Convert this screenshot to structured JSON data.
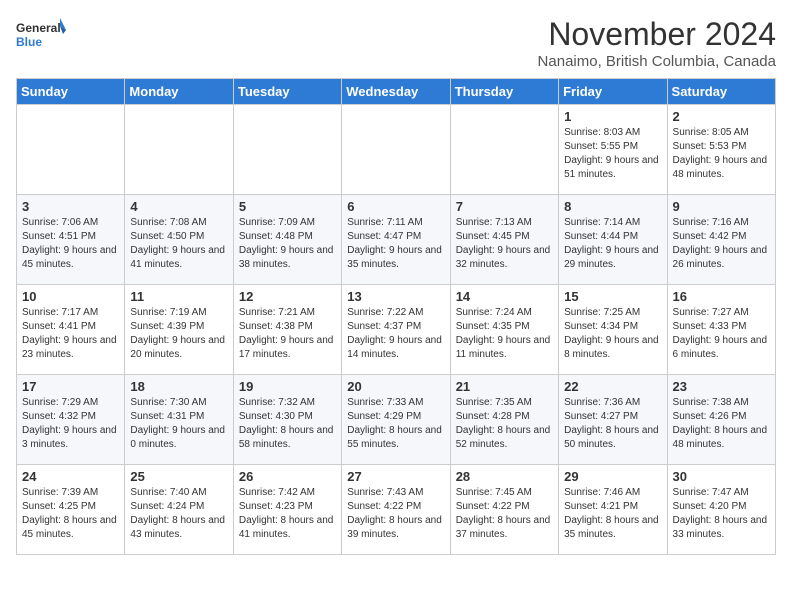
{
  "header": {
    "logo_line1": "General",
    "logo_line2": "Blue",
    "month": "November 2024",
    "location": "Nanaimo, British Columbia, Canada"
  },
  "weekdays": [
    "Sunday",
    "Monday",
    "Tuesday",
    "Wednesday",
    "Thursday",
    "Friday",
    "Saturday"
  ],
  "weeks": [
    [
      {
        "day": "",
        "info": ""
      },
      {
        "day": "",
        "info": ""
      },
      {
        "day": "",
        "info": ""
      },
      {
        "day": "",
        "info": ""
      },
      {
        "day": "",
        "info": ""
      },
      {
        "day": "1",
        "info": "Sunrise: 8:03 AM\nSunset: 5:55 PM\nDaylight: 9 hours and 51 minutes."
      },
      {
        "day": "2",
        "info": "Sunrise: 8:05 AM\nSunset: 5:53 PM\nDaylight: 9 hours and 48 minutes."
      }
    ],
    [
      {
        "day": "3",
        "info": "Sunrise: 7:06 AM\nSunset: 4:51 PM\nDaylight: 9 hours and 45 minutes."
      },
      {
        "day": "4",
        "info": "Sunrise: 7:08 AM\nSunset: 4:50 PM\nDaylight: 9 hours and 41 minutes."
      },
      {
        "day": "5",
        "info": "Sunrise: 7:09 AM\nSunset: 4:48 PM\nDaylight: 9 hours and 38 minutes."
      },
      {
        "day": "6",
        "info": "Sunrise: 7:11 AM\nSunset: 4:47 PM\nDaylight: 9 hours and 35 minutes."
      },
      {
        "day": "7",
        "info": "Sunrise: 7:13 AM\nSunset: 4:45 PM\nDaylight: 9 hours and 32 minutes."
      },
      {
        "day": "8",
        "info": "Sunrise: 7:14 AM\nSunset: 4:44 PM\nDaylight: 9 hours and 29 minutes."
      },
      {
        "day": "9",
        "info": "Sunrise: 7:16 AM\nSunset: 4:42 PM\nDaylight: 9 hours and 26 minutes."
      }
    ],
    [
      {
        "day": "10",
        "info": "Sunrise: 7:17 AM\nSunset: 4:41 PM\nDaylight: 9 hours and 23 minutes."
      },
      {
        "day": "11",
        "info": "Sunrise: 7:19 AM\nSunset: 4:39 PM\nDaylight: 9 hours and 20 minutes."
      },
      {
        "day": "12",
        "info": "Sunrise: 7:21 AM\nSunset: 4:38 PM\nDaylight: 9 hours and 17 minutes."
      },
      {
        "day": "13",
        "info": "Sunrise: 7:22 AM\nSunset: 4:37 PM\nDaylight: 9 hours and 14 minutes."
      },
      {
        "day": "14",
        "info": "Sunrise: 7:24 AM\nSunset: 4:35 PM\nDaylight: 9 hours and 11 minutes."
      },
      {
        "day": "15",
        "info": "Sunrise: 7:25 AM\nSunset: 4:34 PM\nDaylight: 9 hours and 8 minutes."
      },
      {
        "day": "16",
        "info": "Sunrise: 7:27 AM\nSunset: 4:33 PM\nDaylight: 9 hours and 6 minutes."
      }
    ],
    [
      {
        "day": "17",
        "info": "Sunrise: 7:29 AM\nSunset: 4:32 PM\nDaylight: 9 hours and 3 minutes."
      },
      {
        "day": "18",
        "info": "Sunrise: 7:30 AM\nSunset: 4:31 PM\nDaylight: 9 hours and 0 minutes."
      },
      {
        "day": "19",
        "info": "Sunrise: 7:32 AM\nSunset: 4:30 PM\nDaylight: 8 hours and 58 minutes."
      },
      {
        "day": "20",
        "info": "Sunrise: 7:33 AM\nSunset: 4:29 PM\nDaylight: 8 hours and 55 minutes."
      },
      {
        "day": "21",
        "info": "Sunrise: 7:35 AM\nSunset: 4:28 PM\nDaylight: 8 hours and 52 minutes."
      },
      {
        "day": "22",
        "info": "Sunrise: 7:36 AM\nSunset: 4:27 PM\nDaylight: 8 hours and 50 minutes."
      },
      {
        "day": "23",
        "info": "Sunrise: 7:38 AM\nSunset: 4:26 PM\nDaylight: 8 hours and 48 minutes."
      }
    ],
    [
      {
        "day": "24",
        "info": "Sunrise: 7:39 AM\nSunset: 4:25 PM\nDaylight: 8 hours and 45 minutes."
      },
      {
        "day": "25",
        "info": "Sunrise: 7:40 AM\nSunset: 4:24 PM\nDaylight: 8 hours and 43 minutes."
      },
      {
        "day": "26",
        "info": "Sunrise: 7:42 AM\nSunset: 4:23 PM\nDaylight: 8 hours and 41 minutes."
      },
      {
        "day": "27",
        "info": "Sunrise: 7:43 AM\nSunset: 4:22 PM\nDaylight: 8 hours and 39 minutes."
      },
      {
        "day": "28",
        "info": "Sunrise: 7:45 AM\nSunset: 4:22 PM\nDaylight: 8 hours and 37 minutes."
      },
      {
        "day": "29",
        "info": "Sunrise: 7:46 AM\nSunset: 4:21 PM\nDaylight: 8 hours and 35 minutes."
      },
      {
        "day": "30",
        "info": "Sunrise: 7:47 AM\nSunset: 4:20 PM\nDaylight: 8 hours and 33 minutes."
      }
    ]
  ]
}
